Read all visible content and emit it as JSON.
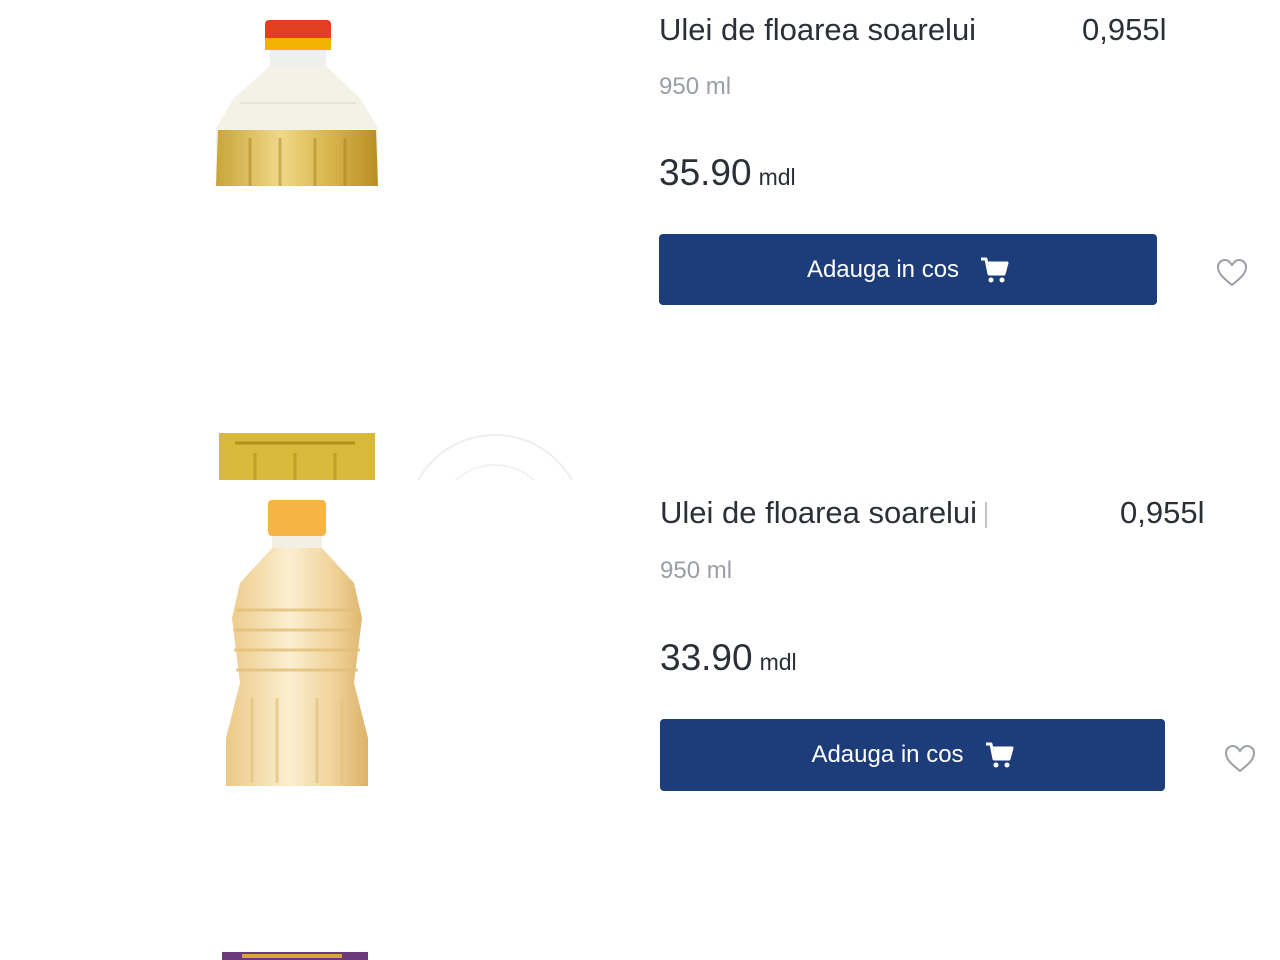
{
  "products": [
    {
      "title": "Ulei de floarea soarelui",
      "volume_label": "0,955l",
      "subtitle": "950 ml",
      "price": "35.90",
      "currency": "mdl",
      "button_label": "Adauga in cos"
    },
    {
      "title": "Ulei de floarea soarelui",
      "volume_label": "0,955l",
      "subtitle": "950 ml",
      "price": "33.90",
      "currency": "mdl",
      "button_label": "Adauga in cos"
    }
  ],
  "colors": {
    "button_bg": "#1c3c7a",
    "text_dark": "#2b2f38",
    "text_muted": "#9a9ea5"
  },
  "icons": [
    "cart-icon",
    "heart-icon",
    "bottle-image"
  ]
}
